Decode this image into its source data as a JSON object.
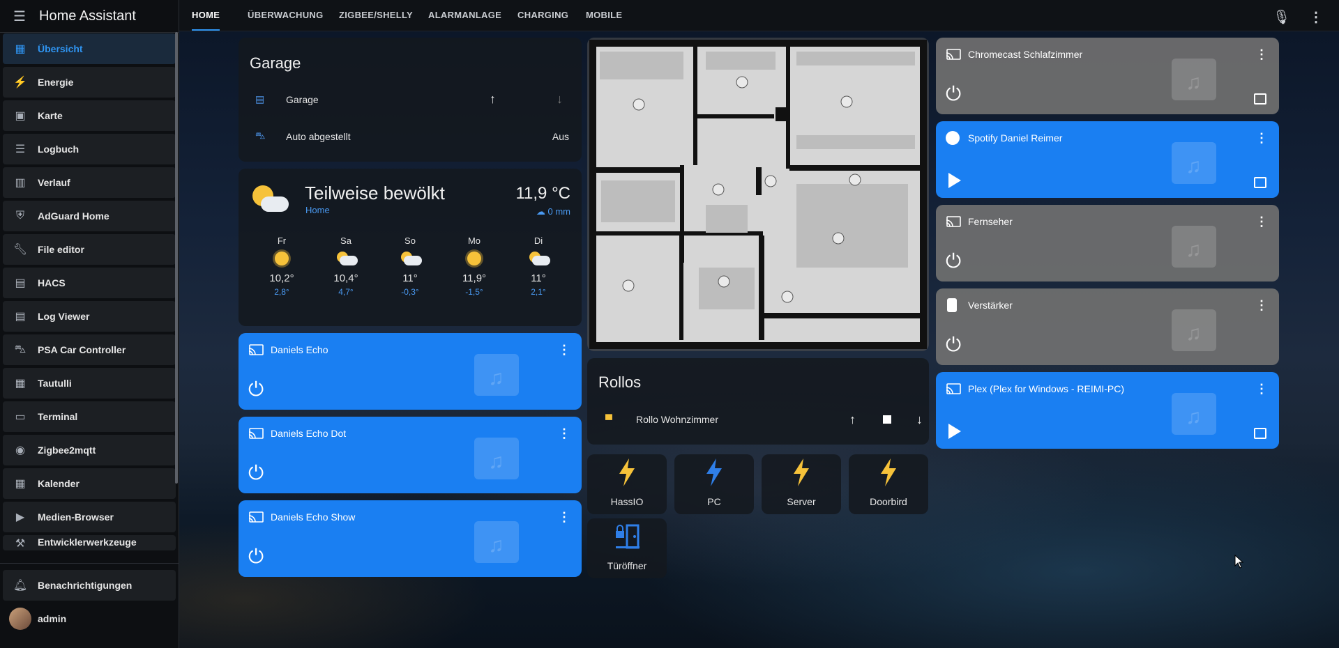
{
  "app": {
    "title": "Home Assistant"
  },
  "sidebar": {
    "items": [
      {
        "label": "Übersicht",
        "icon": "dashboard-icon"
      },
      {
        "label": "Energie",
        "icon": "lightning-icon"
      },
      {
        "label": "Karte",
        "icon": "map-icon"
      },
      {
        "label": "Logbuch",
        "icon": "list-icon"
      },
      {
        "label": "Verlauf",
        "icon": "chart-icon"
      },
      {
        "label": "AdGuard Home",
        "icon": "shield-icon"
      },
      {
        "label": "File editor",
        "icon": "wrench-icon"
      },
      {
        "label": "HACS",
        "icon": "store-icon"
      },
      {
        "label": "Log Viewer",
        "icon": "document-icon"
      },
      {
        "label": "PSA Car Controller",
        "icon": "car-icon"
      },
      {
        "label": "Tautulli",
        "icon": "film-icon"
      },
      {
        "label": "Terminal",
        "icon": "terminal-icon"
      },
      {
        "label": "Zigbee2mqtt",
        "icon": "compass-icon"
      },
      {
        "label": "Kalender",
        "icon": "calendar-icon"
      },
      {
        "label": "Medien-Browser",
        "icon": "play-box-icon"
      },
      {
        "label": "Entwicklerwerkzeuge",
        "icon": "hammer-icon"
      }
    ],
    "notifications": "Benachrichtigungen",
    "user": "admin"
  },
  "tabs": [
    "HOME",
    "ÜBERWACHUNG",
    "ZIGBEE/SHELLY",
    "ALARMANLAGE",
    "CHARGING",
    "MOBILE"
  ],
  "garage": {
    "title": "Garage",
    "rows": [
      {
        "label": "Garage"
      },
      {
        "label": "Auto abgestellt",
        "state": "Aus"
      }
    ]
  },
  "weather": {
    "condition": "Teilweise bewölkt",
    "location": "Home",
    "temperature": "11,9 °C",
    "precipitation": "0 mm",
    "forecast": [
      {
        "day": "Fr",
        "high": "10,2°",
        "low": "2,8°",
        "icon": "sun"
      },
      {
        "day": "Sa",
        "high": "10,4°",
        "low": "4,7°",
        "icon": "partly-cloudy"
      },
      {
        "day": "So",
        "high": "11°",
        "low": "-0,3°",
        "icon": "partly-cloudy"
      },
      {
        "day": "Mo",
        "high": "11,9°",
        "low": "-1,5°",
        "icon": "sun"
      },
      {
        "day": "Di",
        "high": "11°",
        "low": "2,1°",
        "icon": "partly-cloudy"
      }
    ]
  },
  "media_left": [
    {
      "name": "Daniels Echo"
    },
    {
      "name": "Daniels Echo Dot"
    },
    {
      "name": "Daniels Echo Show"
    }
  ],
  "media_right": [
    {
      "name": "Chromecast Schlafzimmer",
      "color": "gray"
    },
    {
      "name": "Spotify Daniel Reimer",
      "color": "blue"
    },
    {
      "name": "Fernseher",
      "color": "gray"
    },
    {
      "name": "Verstärker",
      "color": "gray"
    },
    {
      "name": "Plex (Plex for Windows - REIMI-PC)",
      "color": "blue"
    }
  ],
  "rollos": {
    "title": "Rollos",
    "row": "Rollo Wohnzimmer"
  },
  "buttons": [
    {
      "label": "HassIO",
      "color": "#f6c23a"
    },
    {
      "label": "PC",
      "color": "#2f7fe8"
    },
    {
      "label": "Server",
      "color": "#f6c23a"
    },
    {
      "label": "Doorbird",
      "color": "#f6c23a"
    },
    {
      "label": "Türöffner",
      "color": "#2f7fe8"
    }
  ]
}
